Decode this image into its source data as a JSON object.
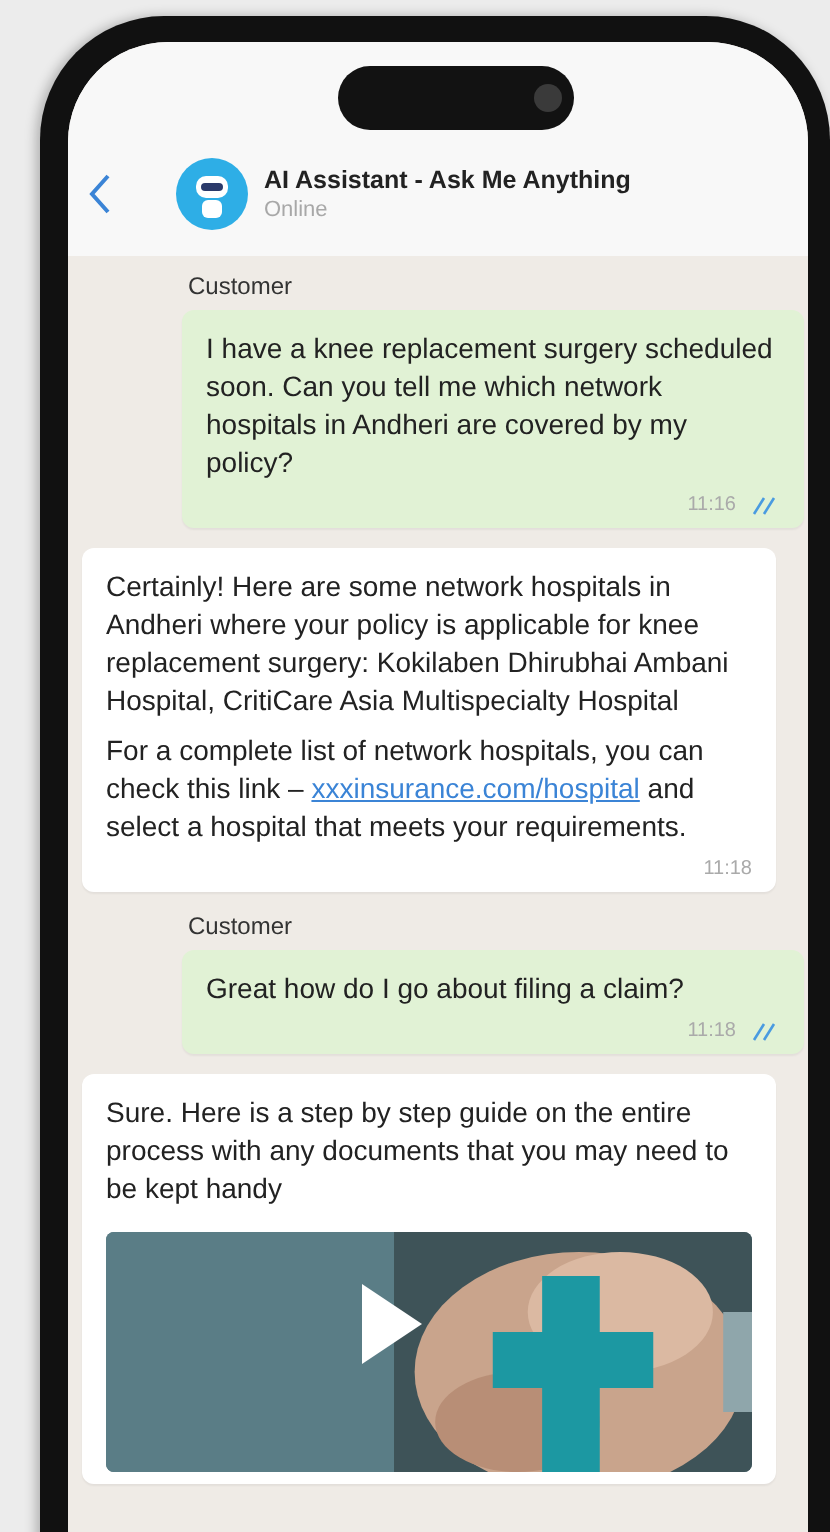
{
  "header": {
    "title": "AI Assistant - Ask Me Anything",
    "status": "Online"
  },
  "messages": [
    {
      "kind": "outgoing",
      "sender": "Customer",
      "text": "I have a knee replacement surgery scheduled soon. Can you tell me which network hospitals in Andheri are covered by my policy?",
      "time": "11:16",
      "read": true
    },
    {
      "kind": "incoming",
      "paragraphs": [
        [
          {
            "kind": "text",
            "text": "Certainly! Here are some network hospitals in Andheri where your policy is applicable for knee replacement surgery: Kokilaben Dhirubhai Ambani Hospital, CritiCare Asia Multispecialty Hospital"
          }
        ],
        [
          {
            "kind": "text",
            "text": "For a complete list of network hospitals, you can check this link – "
          },
          {
            "kind": "link",
            "text": "xxxinsurance.com/hospital"
          },
          {
            "kind": "text",
            "text": " and select a hospital that meets your requirements."
          }
        ]
      ],
      "time": "11:18"
    },
    {
      "kind": "outgoing",
      "sender": "Customer",
      "text": "Great how do I go about filing a claim?",
      "time": "11:18",
      "read": true
    },
    {
      "kind": "incoming",
      "paragraphs": [
        [
          {
            "kind": "text",
            "text": "Sure. Here is a step by step guide on the entire process with any documents that you may need to be kept handy"
          }
        ]
      ],
      "media": {
        "kind": "video"
      }
    }
  ]
}
